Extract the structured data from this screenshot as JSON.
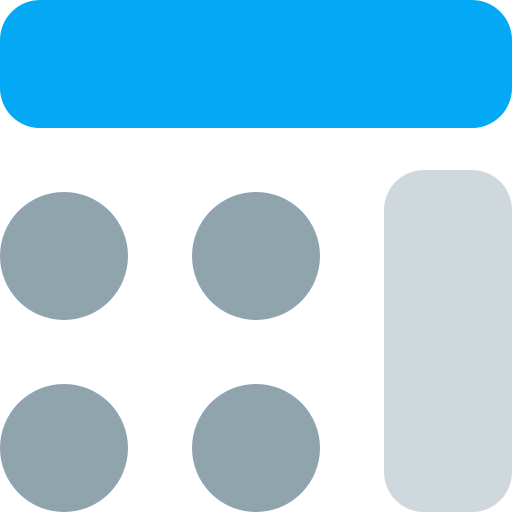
{
  "icon": {
    "name": "calculator-icon",
    "colors": {
      "display": "#03A9F4",
      "keys": "#90A4AE",
      "tall_key": "#CFD8DC",
      "background": "#FFFFFF"
    }
  }
}
